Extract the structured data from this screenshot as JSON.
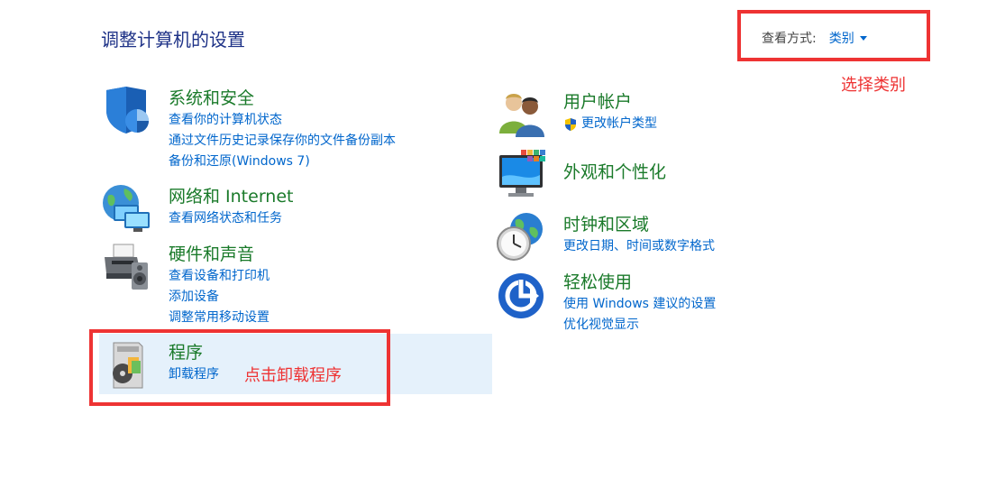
{
  "page_title": "调整计算机的设置",
  "view_by": {
    "label": "查看方式:",
    "value": "类别"
  },
  "annotations": {
    "select_category": "选择类别",
    "click_uninstall": "点击卸载程序"
  },
  "left_column": [
    {
      "title": "系统和安全",
      "links": [
        "查看你的计算机状态",
        "通过文件历史记录保存你的文件备份副本",
        "备份和还原(Windows 7)"
      ]
    },
    {
      "title": "网络和 Internet",
      "links": [
        "查看网络状态和任务"
      ]
    },
    {
      "title": "硬件和声音",
      "links": [
        "查看设备和打印机",
        "添加设备",
        "调整常用移动设置"
      ]
    },
    {
      "title": "程序",
      "links": [
        "卸载程序"
      ]
    }
  ],
  "right_column": [
    {
      "title": "用户帐户",
      "links": [
        "更改帐户类型"
      ]
    },
    {
      "title": "外观和个性化",
      "links": []
    },
    {
      "title": "时钟和区域",
      "links": [
        "更改日期、时间或数字格式"
      ]
    },
    {
      "title": "轻松使用",
      "links": [
        "使用 Windows 建议的设置",
        "优化视觉显示"
      ]
    }
  ],
  "colors": {
    "title_blue": "#1e3287",
    "category_green": "#1a7a2a",
    "link_blue": "#0066cc",
    "annotation_red": "#ee3333",
    "hover_bg": "#e5f1fb"
  }
}
